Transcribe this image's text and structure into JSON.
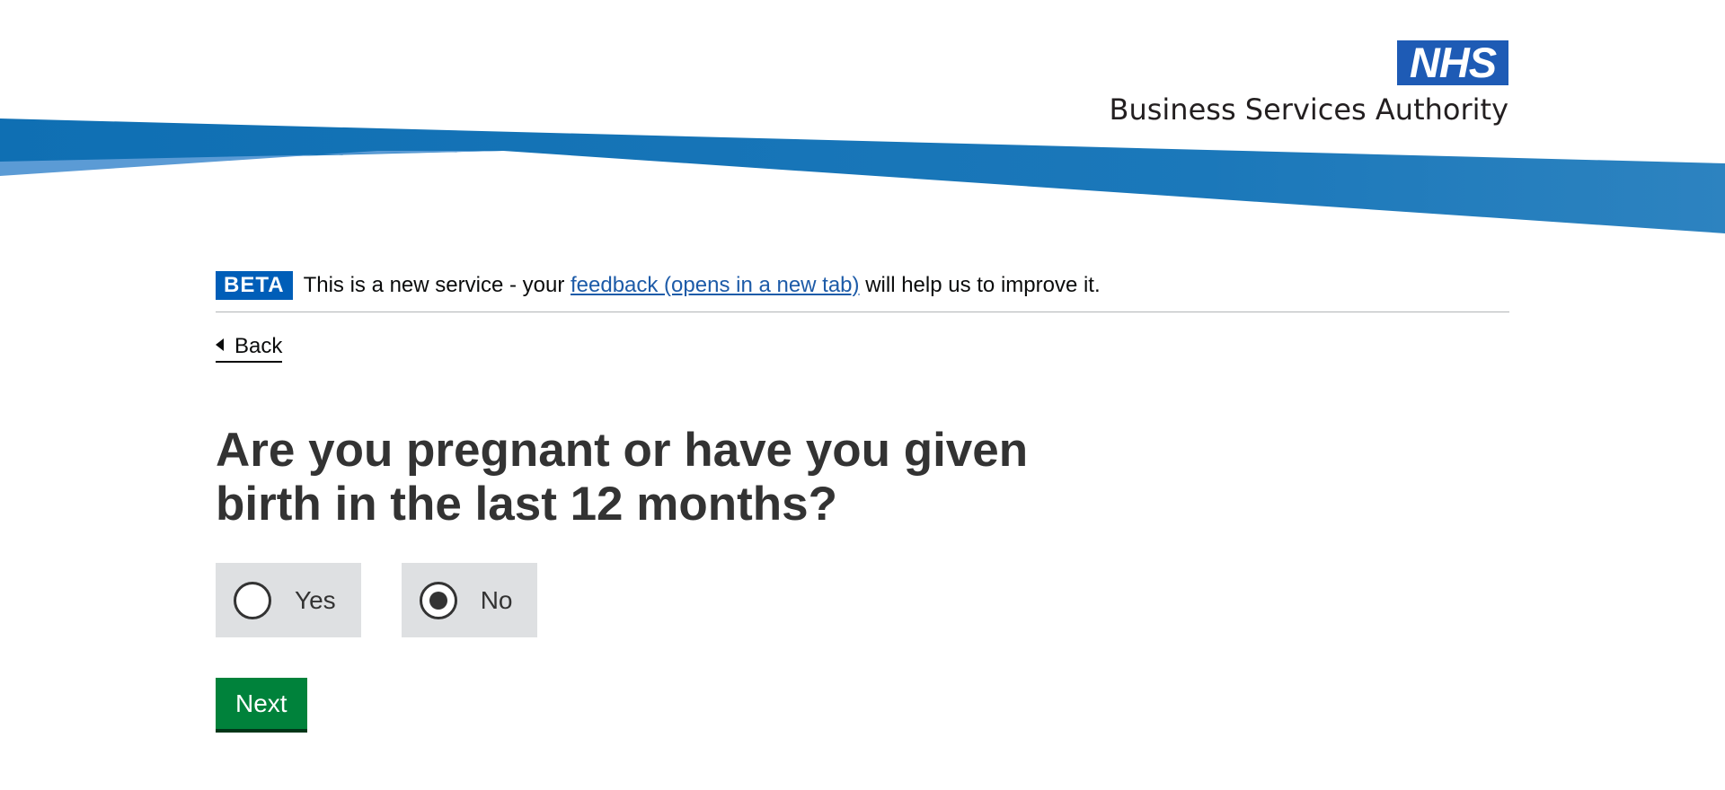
{
  "header": {
    "logo_mark": "NHS",
    "org_name": "Business Services Authority",
    "brand_color": "#005eb8"
  },
  "phase_banner": {
    "tag": "BETA",
    "text_before": "This is a new service - your ",
    "link_text": "feedback (opens in a new tab)",
    "text_after": " will help us to improve it."
  },
  "back_link": {
    "icon": "triangle-left-icon",
    "label": "Back"
  },
  "question": {
    "title": "Are you pregnant or have you given birth in the last 12 months?",
    "options": [
      {
        "label": "Yes",
        "checked": false
      },
      {
        "label": "No",
        "checked": true
      }
    ]
  },
  "actions": {
    "next_label": "Next",
    "next_color": "#00823b"
  }
}
